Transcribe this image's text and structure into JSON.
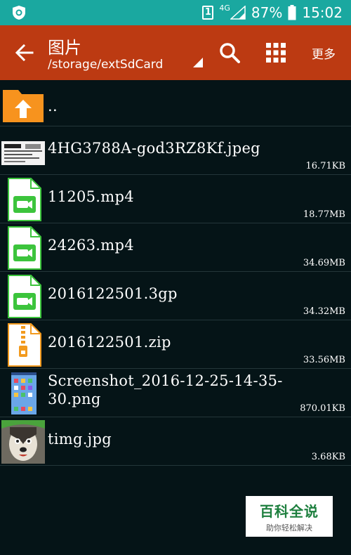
{
  "status_bar": {
    "sim": "1",
    "network": "4G",
    "battery": "87%",
    "time": "15:02"
  },
  "app_bar": {
    "title": "图片",
    "path": "/storage/extSdCard",
    "more_label": "更多"
  },
  "files": [
    {
      "name": "..",
      "size": "",
      "type": "folder-up-icon"
    },
    {
      "name": "4HG3788A-god3RZ8Kf.jpeg",
      "size": "16.71KB",
      "type": "image-thumbnail"
    },
    {
      "name": "11205.mp4",
      "size": "18.77MB",
      "type": "video-file-icon"
    },
    {
      "name": "24263.mp4",
      "size": "34.69MB",
      "type": "video-file-icon"
    },
    {
      "name": "2016122501.3gp",
      "size": "34.32MB",
      "type": "video-file-icon"
    },
    {
      "name": "2016122501.zip",
      "size": "33.56MB",
      "type": "zip-file-icon"
    },
    {
      "name": "Screenshot_2016-12-25-14-35-30.png",
      "size": "870.01KB",
      "type": "screenshot-thumbnail"
    },
    {
      "name": "timg.jpg",
      "size": "3.68KB",
      "type": "dog-photo-thumbnail"
    }
  ],
  "watermark": {
    "title": "百科全说",
    "subtitle": "助你轻松解决"
  },
  "colors": {
    "status_bar": "#1aa8a0",
    "app_bar": "#bc3a12",
    "background": "#051417",
    "video_icon": "#3cc43c",
    "zip_icon": "#f29a1e"
  }
}
